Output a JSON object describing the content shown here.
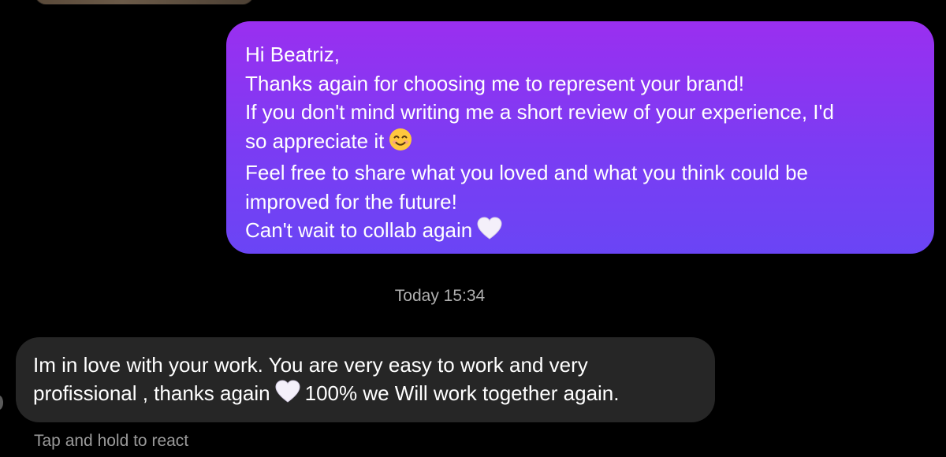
{
  "outgoing_message": {
    "lines": [
      "Hi Beatriz,",
      "Thanks again for choosing me to represent your brand!",
      "If you don't mind writing me a short review of your experience, I'd",
      "so appreciate it",
      "Feel free to share what you loved and what you think could be",
      "improved for the future!",
      "Can't wait to collab again"
    ],
    "emojis": [
      "smiling-face-emoji",
      "white-heart-emoji"
    ]
  },
  "timestamp": "Today 15:34",
  "incoming_message": {
    "line1": "Im in love with your work. You are very easy to work and very",
    "line2_part1": "profissional , thanks again",
    "line2_part2": "100% we Will work together again.",
    "emojis": [
      "white-heart-emoji"
    ]
  },
  "react_hint": "Tap and hold to react",
  "colors": {
    "background": "#000000",
    "outgoing_bubble_top": "#9a2ff0",
    "outgoing_bubble_bottom": "#6a45f5",
    "incoming_bubble": "#262626",
    "meta_text": "#b0b0b0"
  }
}
